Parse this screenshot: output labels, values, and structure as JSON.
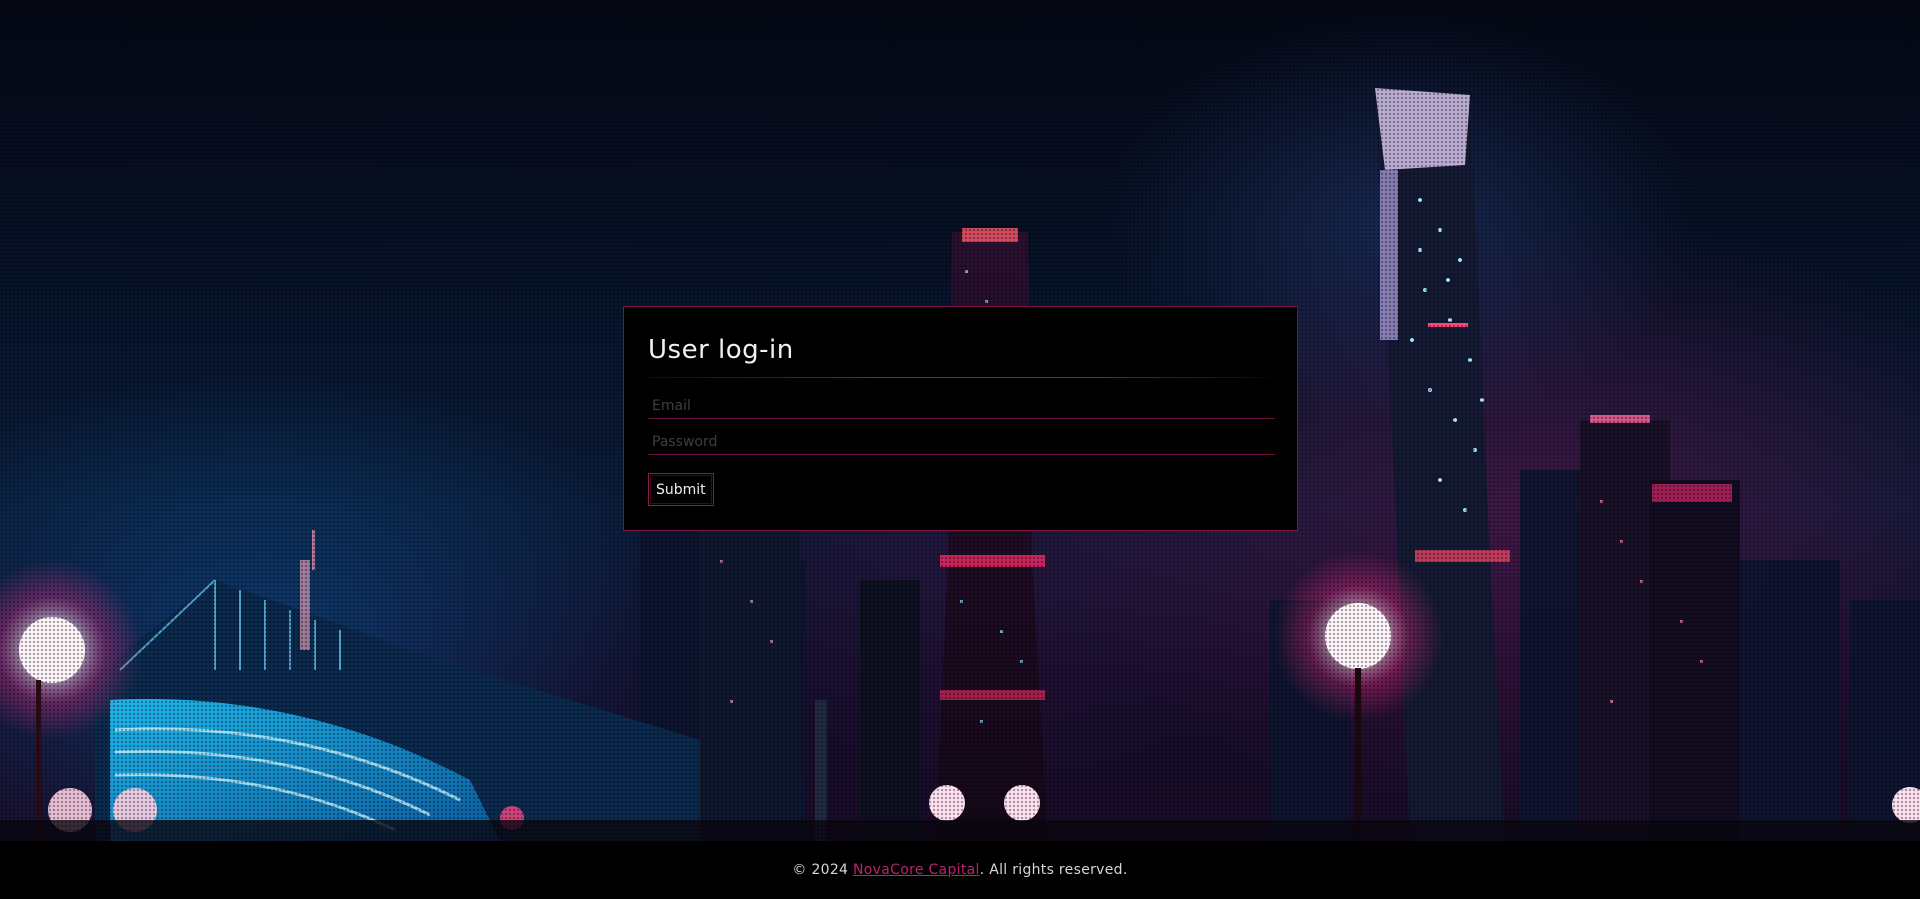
{
  "login": {
    "title": "User log-in",
    "email_placeholder": "Email",
    "password_placeholder": "Password",
    "submit_label": "Submit"
  },
  "footer": {
    "copyright_prefix": "© 2024 ",
    "company_link": "NovaCore Capital",
    "copyright_suffix": ". All rights reserved."
  },
  "colors": {
    "accent": "#b8246e",
    "card_border": "#7a1446",
    "card_background": "#000000",
    "footer_background": "#000000"
  }
}
